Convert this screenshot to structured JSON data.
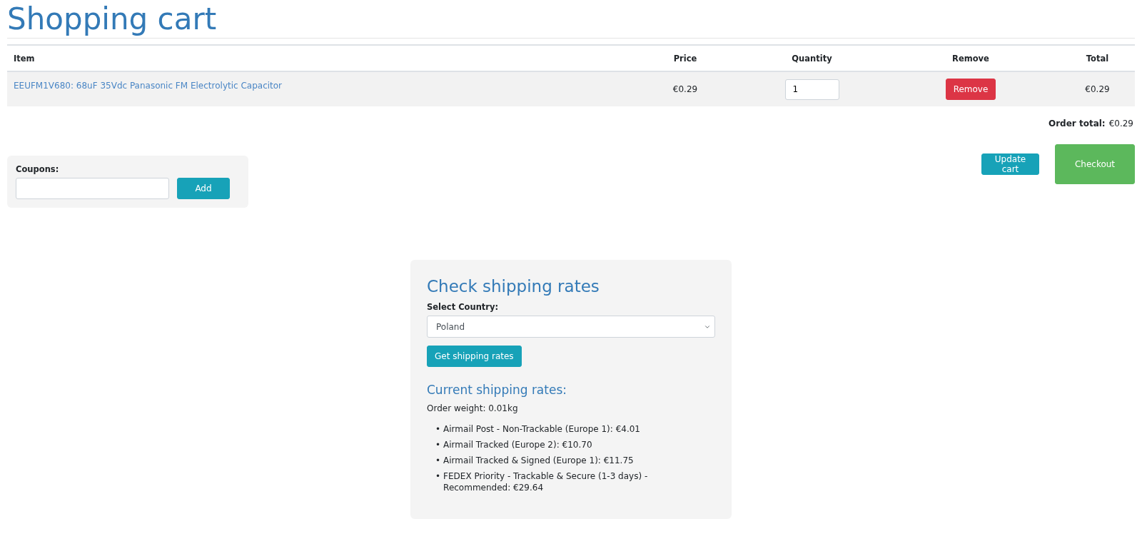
{
  "page_title": "Shopping cart",
  "table": {
    "columns": [
      "Item",
      "Price",
      "Quantity",
      "Remove",
      "Total"
    ],
    "rows": [
      {
        "item": "EEUFM1V680: 68uF 35Vdc Panasonic FM Electrolytic Capacitor",
        "price": "€0.29",
        "quantity": "1",
        "remove_button": "Remove",
        "total": "€0.29"
      }
    ]
  },
  "order_total": {
    "label": "Order total:",
    "value": "€0.29"
  },
  "coupons": {
    "label": "Coupons:",
    "button": "Add"
  },
  "buttons": {
    "update": "Update cart",
    "checkout": "Checkout"
  },
  "shipping": {
    "title": "Check shipping rates",
    "country_label": "Select Country:",
    "country": "Poland",
    "button": "Get shipping rates",
    "rates_title": "Current shipping rates:",
    "weight": "Order weight: 0.01kg",
    "rates": [
      {
        "bullet": "•",
        "text": "Airmail Post - Non-Trackable (Europe 1): €4.01"
      },
      {
        "bullet": "•",
        "text": "Airmail Tracked (Europe 2): €10.70"
      },
      {
        "bullet": "•",
        "text": "Airmail Tracked & Signed (Europe 1): €11.75"
      },
      {
        "bullet": "•",
        "text": "FEDEX Priority - Trackable & Secure (1-3 days) - Recommended: €29.64"
      }
    ]
  }
}
